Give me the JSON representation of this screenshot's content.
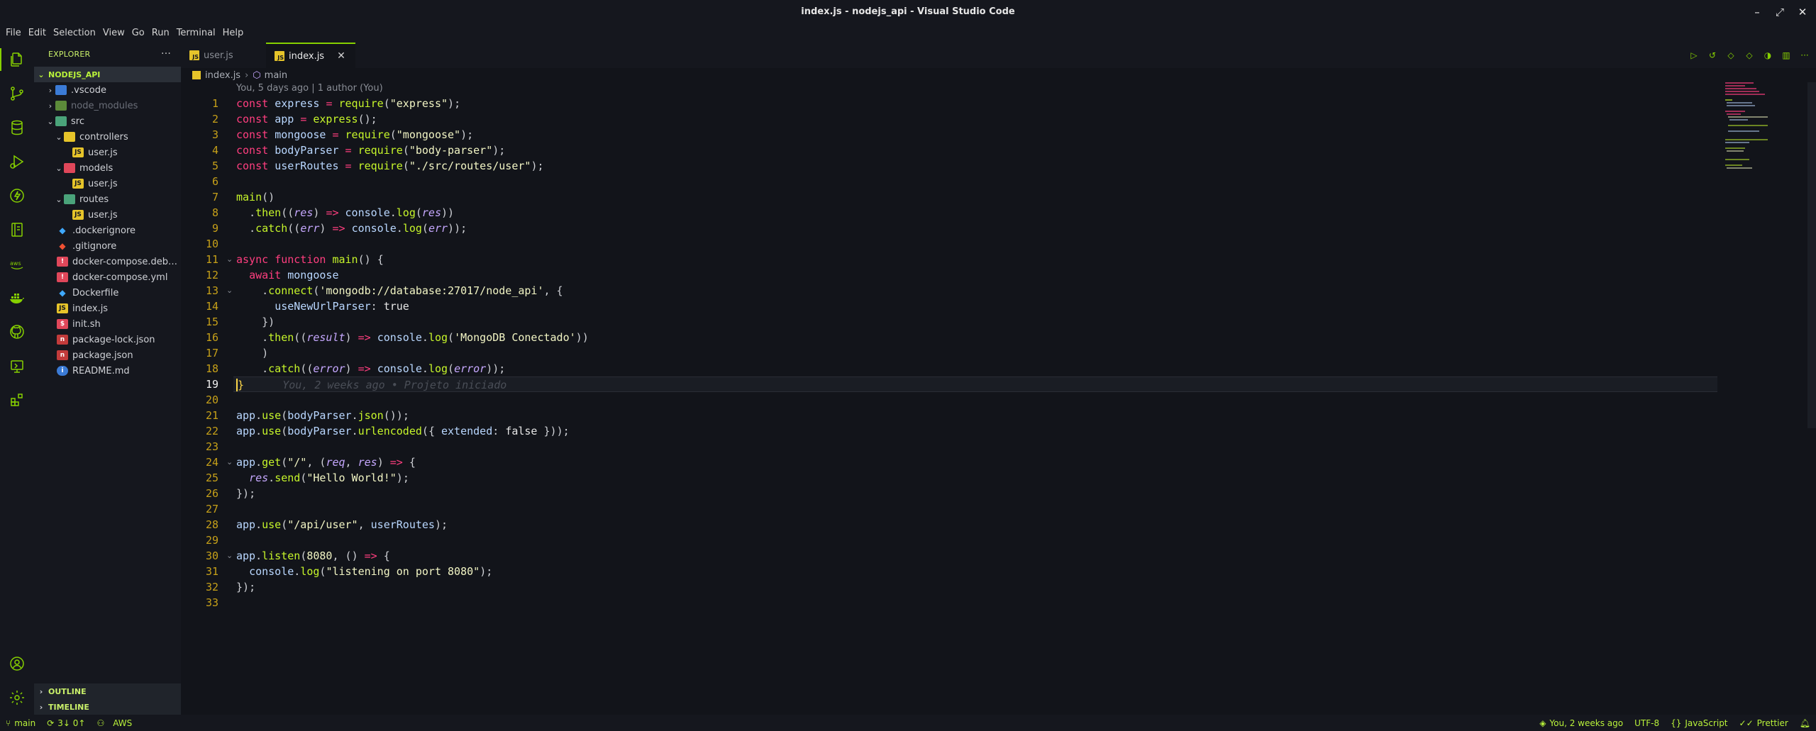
{
  "window": {
    "title": "index.js - nodejs_api - Visual Studio Code"
  },
  "menu": [
    "File",
    "Edit",
    "Selection",
    "View",
    "Go",
    "Run",
    "Terminal",
    "Help"
  ],
  "sidebar": {
    "title": "EXPLORER",
    "root": "NODEJS_API",
    "items": [
      {
        "label": ".vscode",
        "type": "folder",
        "expanded": false,
        "depth": 1
      },
      {
        "label": "node_modules",
        "type": "folder",
        "expanded": false,
        "depth": 1,
        "dimmed": true
      },
      {
        "label": "src",
        "type": "folder",
        "expanded": true,
        "depth": 1
      },
      {
        "label": "controllers",
        "type": "folder",
        "expanded": true,
        "depth": 2
      },
      {
        "label": "user.js",
        "type": "js",
        "depth": 3
      },
      {
        "label": "models",
        "type": "folder",
        "expanded": true,
        "depth": 2
      },
      {
        "label": "user.js",
        "type": "js",
        "depth": 3
      },
      {
        "label": "routes",
        "type": "folder",
        "expanded": true,
        "depth": 2
      },
      {
        "label": "user.js",
        "type": "js",
        "depth": 3
      },
      {
        "label": ".dockerignore",
        "type": "docker",
        "depth": 1
      },
      {
        "label": ".gitignore",
        "type": "git",
        "depth": 1
      },
      {
        "label": "docker-compose.debug.yml",
        "type": "yml",
        "depth": 1
      },
      {
        "label": "docker-compose.yml",
        "type": "yml",
        "depth": 1
      },
      {
        "label": "Dockerfile",
        "type": "docker",
        "depth": 1
      },
      {
        "label": "index.js",
        "type": "js",
        "depth": 1
      },
      {
        "label": "init.sh",
        "type": "sh",
        "depth": 1
      },
      {
        "label": "package-lock.json",
        "type": "npm",
        "depth": 1
      },
      {
        "label": "package.json",
        "type": "npm",
        "depth": 1
      },
      {
        "label": "README.md",
        "type": "info",
        "depth": 1
      }
    ],
    "panels": [
      "OUTLINE",
      "TIMELINE"
    ]
  },
  "tabs": [
    {
      "label": "user.js",
      "active": false
    },
    {
      "label": "index.js",
      "active": true
    }
  ],
  "breadcrumb": {
    "file": "index.js",
    "symbol": "main"
  },
  "codelens": "You, 5 days ago | 1 author (You)",
  "editor": {
    "current_line": 19,
    "blame": "You, 2 weeks ago • Projeto iniciado",
    "line_numbers": [
      "1",
      "2",
      "3",
      "4",
      "5",
      "6",
      "7",
      "8",
      "9",
      "10",
      "11",
      "12",
      "13",
      "14",
      "15",
      "16",
      "17",
      "18",
      "19",
      "20",
      "21",
      "22",
      "23",
      "24",
      "25",
      "26",
      "27",
      "28",
      "29",
      "30",
      "31",
      "32",
      "33"
    ],
    "lines": [
      "const express = require(\"express\");",
      "const app = express();",
      "const mongoose = require(\"mongoose\");",
      "const bodyParser = require(\"body-parser\");",
      "const userRoutes = require(\"./src/routes/user\");",
      "",
      "main()",
      "  .then((res) => console.log(res))",
      "  .catch((err) => console.log(err));",
      "",
      "async function main() {",
      "  await mongoose",
      "    .connect('mongodb://database:27017/node_api', {",
      "      useNewUrlParser: true",
      "    })",
      "    .then((result) => console.log('MongoDB Conectado'))",
      "    )",
      "    .catch((error) => console.log(error));",
      "}",
      "",
      "app.use(bodyParser.json());",
      "app.use(bodyParser.urlencoded({ extended: false }));",
      "",
      "app.get(\"/\", (req, res) => {",
      "  res.send(\"Hello World!\");",
      "});",
      "",
      "app.use(\"/api/user\", userRoutes);",
      "",
      "app.listen(8080, () => {",
      "  console.log(\"listening on port 8080\");",
      "});",
      ""
    ]
  },
  "statusbar": {
    "branch": "main",
    "sync": "3↓ 0↑",
    "aws": "AWS",
    "blame": "You, 2 weeks ago",
    "encoding": "UTF-8",
    "language": "JavaScript",
    "formatter": "Prettier"
  },
  "colors": {
    "accent": "#86d000",
    "background": "#12141a",
    "chrome": "#15171e"
  }
}
